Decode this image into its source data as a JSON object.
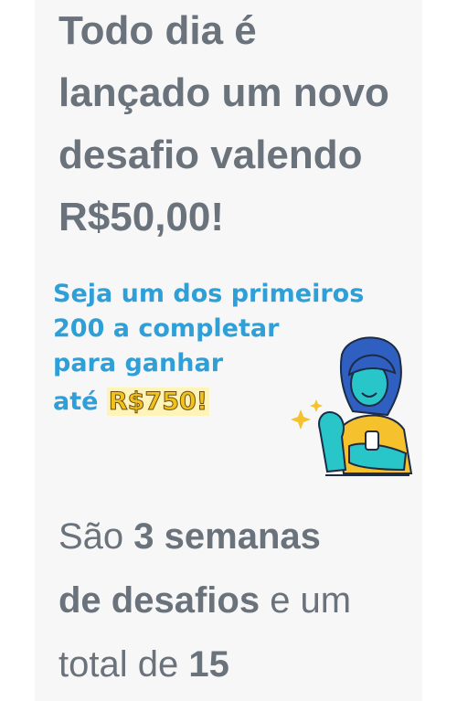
{
  "headline": {
    "line1": "Todo dia é",
    "line2": "lançado um novo",
    "line3": "desafio valendo",
    "line4": "R$50,00!"
  },
  "promo": {
    "line1": "Seja um dos primeiros",
    "line2": "200 a completar",
    "line3": "para ganhar",
    "line4_prefix": "até ",
    "line4_amount": "R$750!",
    "colors": {
      "text": "#2f9fd8",
      "amount": "#f2c21b",
      "shirt": "#f5c12c",
      "hair": "#2f5fc0",
      "skin": "#29c6c9"
    }
  },
  "body": {
    "t1": "São ",
    "b1": "3 semanas",
    "b2": "de desafios",
    "t2": " e um",
    "t3": "total de ",
    "b3": "15"
  }
}
